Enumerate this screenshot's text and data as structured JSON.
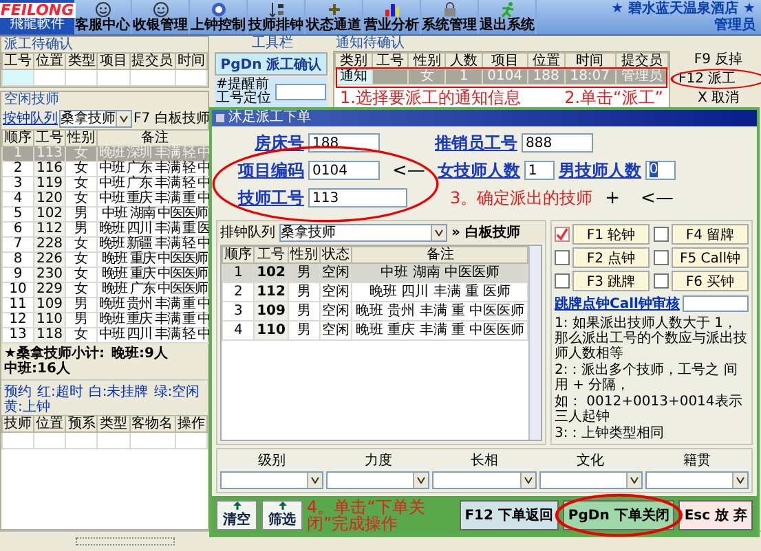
{
  "app": {
    "logo": "FEILONG",
    "logo_subtitle": "飛龍軟件",
    "hotel": "★ 碧水蓝天温泉酒店 ★",
    "user": "管理员"
  },
  "toolbar": [
    "客服中心",
    "收银管理",
    "上钟控制",
    "技师排钟",
    "状态通道",
    "营业分析",
    "系统管理",
    "退出系统"
  ],
  "dispatch_pending": {
    "title": "派工待确认",
    "columns": [
      "工号",
      "位置",
      "类型",
      "项目",
      "提交员",
      "时间"
    ]
  },
  "tools": {
    "title": "工具栏",
    "confirm_button": "PgDn 派工确认",
    "locate_label": "#提醒前工号定位"
  },
  "notices": {
    "title": "通知待确认",
    "columns": [
      "类别",
      "工号",
      "性别",
      "人数",
      "项目",
      "位置",
      "时间",
      "提交员"
    ],
    "rows": [
      {
        "cells": [
          "通知",
          "",
          "女",
          "1",
          "0104",
          "188",
          "18:07",
          "管理员"
        ],
        "selected": true
      }
    ],
    "buttons": [
      "F9 反掉",
      "F12 派工",
      "X 取消"
    ]
  },
  "idle": {
    "title": "空闲技师",
    "queue_link": "按钟队列",
    "queue_value": "桑拿技师",
    "whiteboard": "F7 白板技师",
    "columns": [
      "顺序",
      "工号",
      "性别",
      "备注"
    ],
    "rows": [
      {
        "cells": [
          "1",
          "113",
          "女",
          "晚班 深圳 丰满 轻 中"
        ],
        "selected": true
      },
      {
        "cells": [
          "2",
          "116",
          "女",
          "中班 广东 丰满 轻 中"
        ],
        "selected": false
      },
      {
        "cells": [
          "3",
          "119",
          "女",
          "中班 广东 丰满 轻 中"
        ],
        "selected": false
      },
      {
        "cells": [
          "4",
          "120",
          "女",
          "中班 重庆 丰满 重 中"
        ],
        "selected": false
      },
      {
        "cells": [
          "5",
          "102",
          "男",
          "中班 湖南 中医医师"
        ],
        "selected": false
      },
      {
        "cells": [
          "6",
          "112",
          "男",
          "晚班 四川 丰满 重 医"
        ],
        "selected": false
      },
      {
        "cells": [
          "7",
          "228",
          "女",
          "晚班 新疆 丰满 轻 中"
        ],
        "selected": false
      },
      {
        "cells": [
          "8",
          "226",
          "女",
          "晚班 重庆 中医医师"
        ],
        "selected": false
      },
      {
        "cells": [
          "9",
          "230",
          "女",
          "晚班 重庆 中医医师"
        ],
        "selected": false
      },
      {
        "cells": [
          "10",
          "229",
          "女",
          "晚班 广东 中医医师"
        ],
        "selected": false
      },
      {
        "cells": [
          "11",
          "109",
          "男",
          "晚班 贵州 丰满 重 中"
        ],
        "selected": false
      },
      {
        "cells": [
          "12",
          "110",
          "男",
          "晚班 重庆 丰满 重 中"
        ],
        "selected": false
      },
      {
        "cells": [
          "13",
          "118",
          "女",
          "中班 四川 丰满 轻 中"
        ],
        "selected": false
      }
    ],
    "summary": [
      "★桑拿技师小计:",
      "晚班:9人",
      "中班:16人"
    ],
    "legend": [
      "预约",
      "红:超时",
      "白:未挂牌",
      "绿:空闲",
      "黄:上钟"
    ],
    "booking_columns": [
      "技师",
      "位置",
      "预系",
      "类型",
      "客物名",
      "操作"
    ]
  },
  "dialog": {
    "title": "沐足派工下单",
    "room_label": "房床号",
    "room": "188",
    "seller_label": "推销员工号",
    "seller": "888",
    "item_label": "项目编码",
    "item": "0104",
    "arrow": "<—",
    "female_label": "女技师人数",
    "female": "1",
    "male_label": "男技师人数",
    "male": "0",
    "tech_label": "技师工号",
    "tech": "113",
    "plus": "+",
    "arrow2": "<—",
    "queue_label": "排钟队列",
    "queue_value": "桑拿技师",
    "whiteboard": "» 白板技师",
    "columns": [
      "顺序",
      "工号",
      "性别",
      "状态",
      "备注"
    ],
    "rows": [
      {
        "cells": [
          "1",
          "102",
          "男",
          "空闲",
          "中班 湖南 中医医师"
        ],
        "selected": true
      },
      {
        "cells": [
          "2",
          "112",
          "男",
          "空闲",
          "晚班 四川 丰满 重 医师"
        ],
        "selected": false
      },
      {
        "cells": [
          "3",
          "109",
          "男",
          "空闲",
          "晚班 贵州 丰满 重 中医医师"
        ],
        "selected": false
      },
      {
        "cells": [
          "4",
          "110",
          "男",
          "空闲",
          "晚班 重庆 丰满 重 中医医师"
        ],
        "selected": false
      }
    ],
    "options": [
      {
        "label": "F1 轮钟",
        "checked": true
      },
      {
        "label": "F4 留牌",
        "checked": false
      },
      {
        "label": "F2 点钟",
        "checked": false
      },
      {
        "label": "F5 Call钟",
        "checked": false
      },
      {
        "label": "F3 跳牌",
        "checked": false
      },
      {
        "label": "F6 买钟",
        "checked": false
      }
    ],
    "audit_link": "跳牌点钟Call钟审核",
    "notes": [
      "1: 如果派出技师人数大于 1，那么派出工号的个数应与派出技师人数相等",
      "2:：派出多个技师，工号之 间用 + 分隔，",
      "如： 0012+0013+0014表示三人起钟",
      "3:：上钟类型相同"
    ],
    "filters": [
      "级别",
      "力度",
      "长相",
      "文化",
      "籍贯"
    ],
    "clear_button": "清空",
    "filter_button": "筛选",
    "return_button": "F12 下单返回",
    "close_button": "PgDn 下单关闭",
    "cancel_button": "Esc 放 弃"
  },
  "annotations": [
    "1.选择要派工的通知信息",
    "2.单击“派工”",
    "3。确定派出的技师",
    "4。单击“下单关闭”完成操作"
  ]
}
